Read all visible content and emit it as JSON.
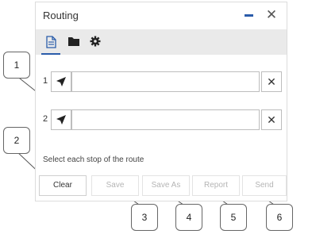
{
  "window": {
    "title": "Routing"
  },
  "toolbar": {
    "tabs": [
      {
        "name": "Directions",
        "icon": "document-icon",
        "active": true
      },
      {
        "name": "Saved routes",
        "icon": "folder-icon",
        "active": false
      },
      {
        "name": "Settings",
        "icon": "gear-icon",
        "active": false
      }
    ]
  },
  "stops": [
    {
      "number": "1",
      "value": ""
    },
    {
      "number": "2",
      "value": ""
    }
  ],
  "hint": "Select each stop of the route",
  "buttons": {
    "clear": "Clear",
    "save": "Save",
    "save_as": "Save As",
    "report": "Report",
    "send": "Send"
  },
  "callouts": [
    "1",
    "2",
    "3",
    "4",
    "5",
    "6"
  ],
  "colors": {
    "accent": "#2a5caa",
    "toolbar_bg": "#eaeaea",
    "disabled_text": "#b5b5b5"
  }
}
